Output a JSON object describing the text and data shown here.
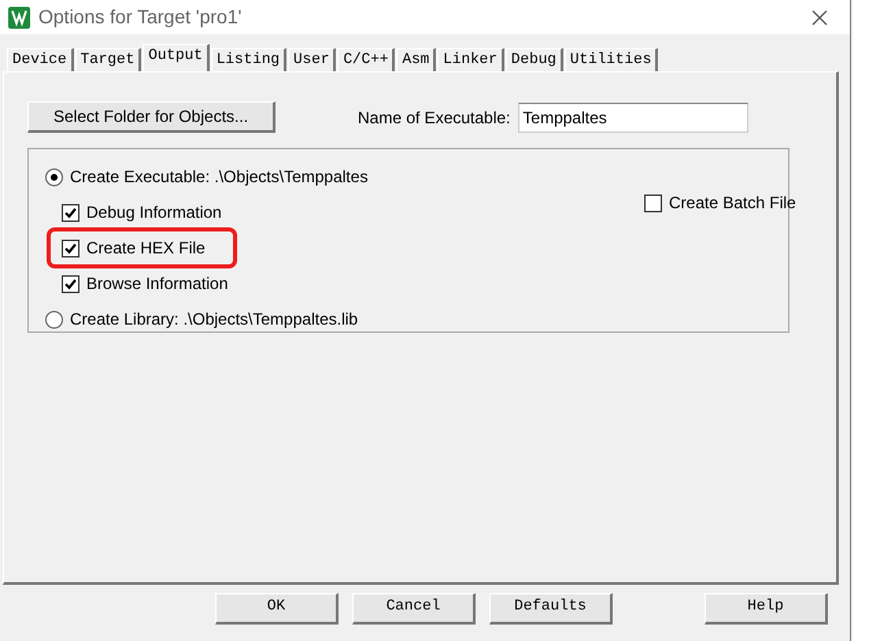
{
  "window": {
    "title": "Options for Target 'pro1'"
  },
  "tabs": [
    {
      "label": "Device",
      "selected": false
    },
    {
      "label": "Target",
      "selected": false
    },
    {
      "label": "Output",
      "selected": true
    },
    {
      "label": "Listing",
      "selected": false
    },
    {
      "label": "User",
      "selected": false
    },
    {
      "label": "C/C++",
      "selected": false
    },
    {
      "label": "Asm",
      "selected": false
    },
    {
      "label": "Linker",
      "selected": false
    },
    {
      "label": "Debug",
      "selected": false
    },
    {
      "label": "Utilities",
      "selected": false
    }
  ],
  "select_folder_button": "Select Folder for Objects...",
  "executable_name": {
    "label": "Name of Executable:",
    "value": "Temppaltes"
  },
  "output_options": [
    {
      "kind": "radio",
      "label": "Create Executable:  .\\Objects\\Temppaltes",
      "selected": true
    },
    {
      "kind": "checkbox",
      "label": "Debug Information",
      "checked": true,
      "highlighted": false
    },
    {
      "kind": "checkbox",
      "label": "Create HEX File",
      "checked": true,
      "highlighted": true
    },
    {
      "kind": "checkbox",
      "label": "Browse Information",
      "checked": true,
      "highlighted": false
    },
    {
      "kind": "radio",
      "label": "Create Library:  .\\Objects\\Temppaltes.lib",
      "selected": false
    }
  ],
  "batch_file": {
    "label": "Create Batch File",
    "checked": false
  },
  "buttons": [
    {
      "label": "OK",
      "kind": "main"
    },
    {
      "label": "Cancel",
      "kind": "main"
    },
    {
      "label": "Defaults",
      "kind": "main"
    },
    {
      "label": "Help",
      "kind": "side"
    }
  ]
}
